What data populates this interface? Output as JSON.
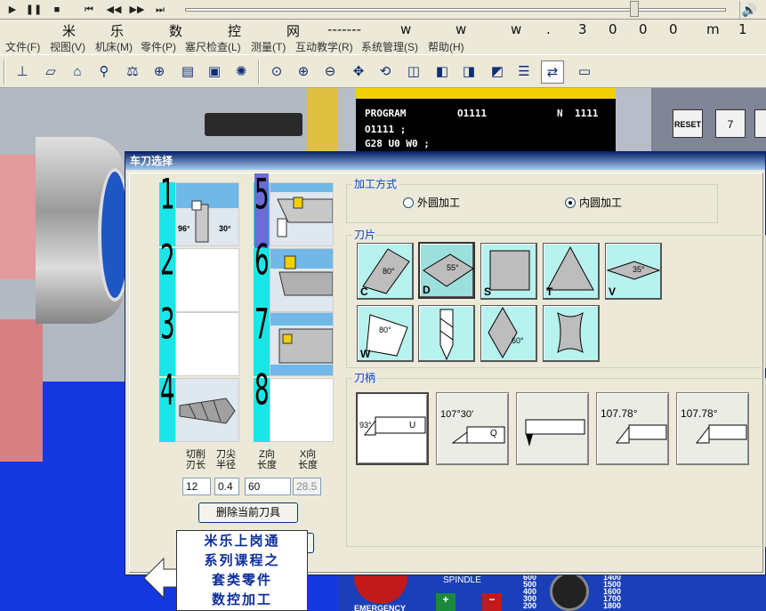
{
  "marquee": [
    "米",
    "乐",
    "数",
    "控",
    "网",
    "-------",
    "w",
    "w",
    "w",
    ".",
    "3",
    "0",
    "0",
    "0",
    "m",
    "1"
  ],
  "menu": [
    "文件(F)",
    "视图(V)",
    "机床(M)",
    "零件(P)",
    "塞尺检查(L)",
    "测量(T)",
    "互动教学(R)",
    "系统管理(S)",
    "帮助(H)"
  ],
  "cnc": {
    "program_label": "PROGRAM",
    "program_number": "O1111",
    "n_label": "N",
    "n_value": "1111",
    "line1": "O1111 ;",
    "line2": "G28 U0 W0 ;",
    "reset_label": "RESET",
    "key7": "7",
    "spindle_label": "SPINDLE",
    "emergency_label": "EMERGENCY",
    "plus": "+",
    "minus": "−",
    "speeds_left": [
      "600",
      "500",
      "400",
      "300",
      "200"
    ],
    "speeds_right": [
      "1400",
      "1500",
      "1600",
      "1700",
      "1800"
    ]
  },
  "dialog": {
    "title": "车刀选择",
    "slots_left": [
      {
        "num": "1",
        "angles": [
          "96°",
          "30°"
        ]
      },
      {
        "num": "2"
      },
      {
        "num": "3"
      },
      {
        "num": "4"
      }
    ],
    "slots_right": [
      {
        "num": "5"
      },
      {
        "num": "6"
      },
      {
        "num": "7"
      },
      {
        "num": "8"
      }
    ],
    "params": {
      "headers": [
        [
          "切削",
          "刃长"
        ],
        [
          "刀尖",
          "半径"
        ],
        [
          "Z向",
          "长度"
        ],
        [
          "X向",
          "长度"
        ]
      ],
      "values": [
        "12",
        "0.4",
        "60",
        "28.5"
      ]
    },
    "delete_button": "删除当前刀具",
    "machining": {
      "label": "加工方式",
      "outer": "外圆加工",
      "inner": "内圆加工",
      "selected": "inner"
    },
    "inserts": {
      "label": "刀片",
      "items": [
        {
          "code": "C",
          "angle": "80°"
        },
        {
          "code": "D",
          "angle": "55°"
        },
        {
          "code": "S",
          "angle": ""
        },
        {
          "code": "T",
          "angle": ""
        },
        {
          "code": "V",
          "angle": "35°"
        },
        {
          "code": "W",
          "angle": "80°"
        },
        {
          "code": "",
          "angle": ""
        },
        {
          "code": "",
          "angle": "60°"
        },
        {
          "code": "",
          "angle": ""
        }
      ]
    },
    "holders": {
      "label": "刀柄",
      "items": [
        {
          "angle": "93°",
          "tag": "U"
        },
        {
          "angle": "107°30'",
          "tag": "Q"
        },
        {
          "angle": "",
          "tag": ""
        },
        {
          "angle": "107.78°",
          "tag": ""
        },
        {
          "angle": "107.78°",
          "tag": ""
        }
      ]
    }
  },
  "promo": [
    "米乐上岗通",
    "系列课程之",
    "套类零件",
    "数控加工"
  ]
}
